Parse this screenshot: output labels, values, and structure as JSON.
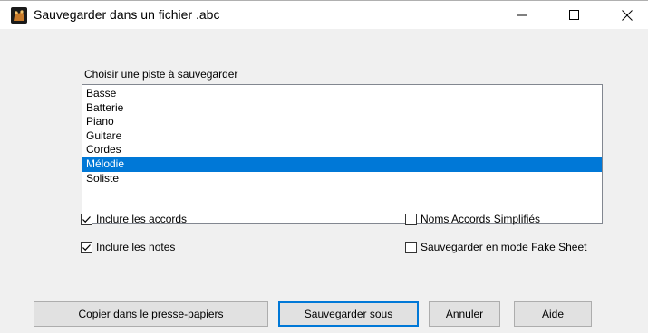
{
  "window": {
    "title": "Sauvegarder dans un fichier .abc",
    "controls": {
      "minimize": "–",
      "maximize": "☐",
      "close": "✕"
    }
  },
  "track_list": {
    "label": "Choisir une piste à sauvegarder",
    "items": [
      "Basse",
      "Batterie",
      "Piano",
      "Guitare",
      "Cordes",
      "Mélodie",
      "Soliste"
    ],
    "selected": "Mélodie"
  },
  "options": {
    "include_chords": {
      "label": "Inclure les accords",
      "checked": true
    },
    "include_notes": {
      "label": "Inclure les notes",
      "checked": true
    },
    "simplified_chord_names": {
      "label": "Noms Accords Simplifiés",
      "checked": false
    },
    "fake_sheet_mode": {
      "label": "Sauvegarder en mode Fake Sheet",
      "checked": false
    }
  },
  "buttons": {
    "copy_clipboard": "Copier dans le presse-papiers",
    "save_as": "Sauvegarder sous",
    "cancel": "Annuler",
    "help": "Aide"
  },
  "colors": {
    "selection": "#0078d7",
    "dialog_bg": "#f0f0f0",
    "default_button_border": "#0078d7"
  }
}
